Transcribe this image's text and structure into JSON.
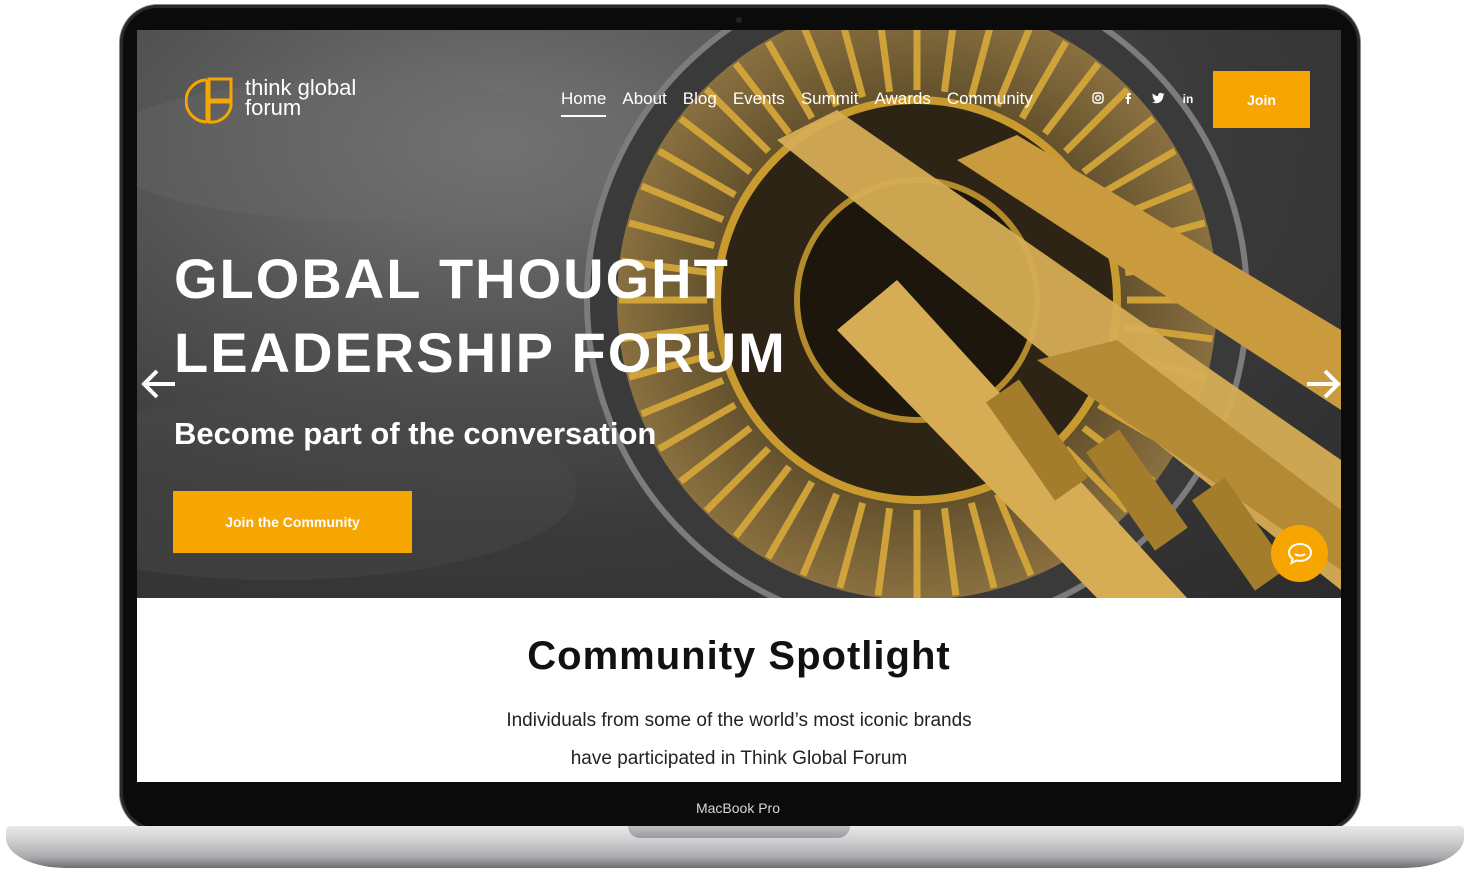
{
  "site": {
    "logo_line1": "think global",
    "logo_line2": "forum"
  },
  "nav": {
    "items": [
      "Home",
      "About",
      "Blog",
      "Events",
      "Summit",
      "Awards",
      "Community"
    ],
    "active": "Home"
  },
  "social": {
    "icons": [
      "instagram-icon",
      "facebook-icon",
      "twitter-icon",
      "linkedin-icon"
    ],
    "linkedin_text": "in"
  },
  "header": {
    "join_label": "Join"
  },
  "hero": {
    "headline_line1": "GLOBAL THOUGHT",
    "headline_line2": "LEADERSHIP FORUM",
    "subheadline": "Become part of the conversation",
    "cta_label": "Join the Community"
  },
  "spotlight": {
    "title": "Community Spotlight",
    "desc_line1": "Individuals from some of the world’s most iconic brands",
    "desc_line2": "have participated in Think Global Forum"
  },
  "device": {
    "label": "MacBook Pro"
  },
  "colors": {
    "accent": "#f7a500",
    "hero_tint": "#c99a2e"
  }
}
